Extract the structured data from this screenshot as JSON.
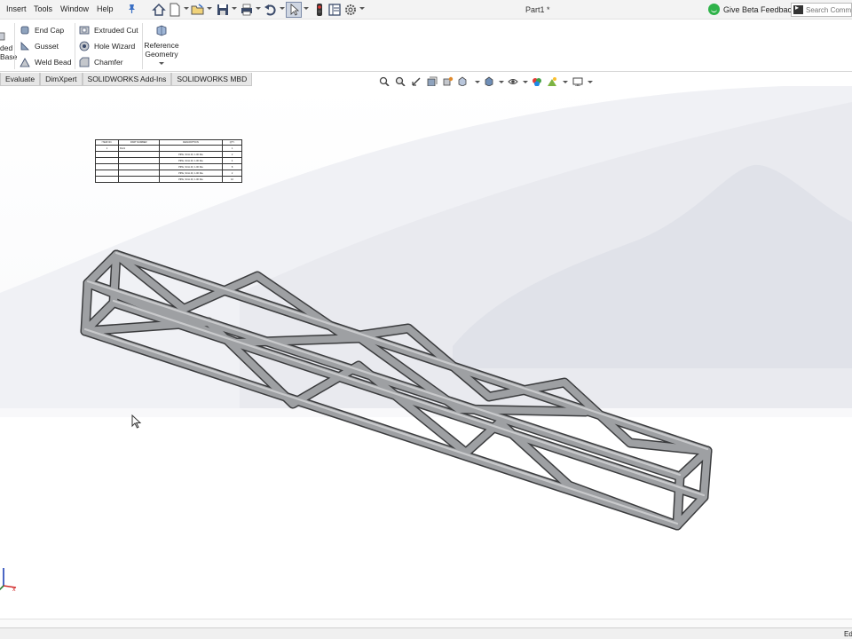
{
  "menu": {
    "items": [
      "Insert",
      "Tools",
      "Window",
      "Help"
    ],
    "pin_icon": "pin-icon"
  },
  "toolbar": {
    "icons": [
      "home-icon",
      "new-document-icon",
      "open-folder-icon",
      "save-icon",
      "print-icon",
      "undo-icon",
      "select-arrow-icon",
      "traffic-light-icon",
      "file-properties-icon",
      "options-gear-icon"
    ],
    "document_title": "Part1 *",
    "feedback_label": "Give Beta Feedback",
    "search_placeholder": "Search Comm"
  },
  "ribbon": {
    "left_label": "ded\nBase",
    "col1": [
      "End Cap",
      "Gusset",
      "Weld Bead"
    ],
    "col2": [
      "Extruded Cut",
      "Hole Wizard",
      "Chamfer"
    ],
    "reference_geometry": "Reference\nGeometry"
  },
  "tabs": [
    "Evaluate",
    "DimXpert",
    "SOLIDWORKS Add-Ins",
    "SOLIDWORKS MBD"
  ],
  "heads_up_icons": [
    "zoom-to-fit-icon",
    "zoom-area-icon",
    "previous-view-icon",
    "section-view-icon",
    "dynamic-annotation-icon",
    "view-orientation-icon",
    "display-style-icon",
    "hide-show-icon",
    "edit-appearance-icon",
    "apply-scene-icon",
    "view-settings-icon"
  ],
  "bom": {
    "headers": [
      "ITEM NO.",
      "PART NUMBER",
      "DESCRIPTION",
      "QTY."
    ],
    "rows": [
      [
        "1",
        "Part1",
        "",
        "1"
      ],
      [
        "",
        "",
        "PIPE, SCH 40, 1.00 Dia",
        "2"
      ],
      [
        "",
        "",
        "PIPE, SCH 40, 1.00 Dia",
        "4"
      ],
      [
        "",
        "",
        "PIPE, SCH 40, 1.00 Dia",
        "8"
      ],
      [
        "",
        "",
        "PIPE, SCH 40, 1.00 Dia",
        "2"
      ],
      [
        "",
        "",
        "PIPE, SCH 40, 1.00 Dia",
        "10"
      ]
    ]
  },
  "status": {
    "text": "Ed"
  },
  "colors": {
    "ribbon_bg": "#ffffff",
    "menubar_bg": "#f3f3f3",
    "tube_face": "#9ea0a3",
    "tube_edge": "#3b3c3e",
    "bg_shape": "#e4e6ec",
    "feedback_green": "#2fb34a"
  }
}
